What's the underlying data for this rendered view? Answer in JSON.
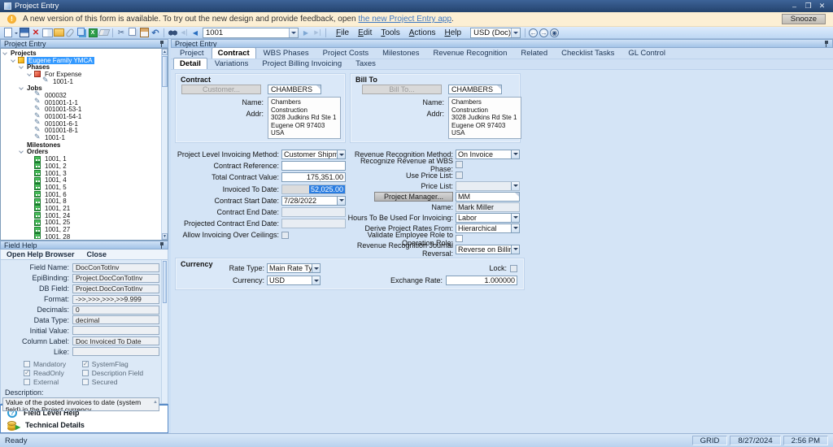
{
  "window": {
    "title": "Project Entry"
  },
  "banner": {
    "message": "A new version of this form is available. To try out the new design and provide feedback, open",
    "link_text": "the new Project Entry app",
    "suffix": ".",
    "snooze_label": "Snooze"
  },
  "toolbar": {
    "record_id": "1001",
    "currency_scope": "USD (Doc)",
    "menus": [
      {
        "label": "File"
      },
      {
        "label": "Edit"
      },
      {
        "label": "Tools"
      },
      {
        "label": "Actions"
      },
      {
        "label": "Help"
      }
    ]
  },
  "left_panel": {
    "header": "Project Entry",
    "tree": {
      "items": [
        {
          "label": "Projects",
          "indent": 0,
          "bold": true,
          "expander": true
        },
        {
          "label": "Eugene Family YMCA",
          "indent": 1,
          "icon": "project-icon",
          "selected": true,
          "expander": true
        },
        {
          "label": "Phases",
          "indent": 2,
          "bold": true,
          "expander": true
        },
        {
          "label": "For Expense",
          "indent": 3,
          "icon": "phase-icon",
          "expander": true
        },
        {
          "label": "1001-1",
          "indent": 4,
          "icon": "job-icon"
        },
        {
          "label": "Jobs",
          "indent": 2,
          "bold": true,
          "expander": true
        },
        {
          "label": "000032",
          "indent": 3,
          "icon": "job-icon"
        },
        {
          "label": "001001-1-1",
          "indent": 3,
          "icon": "job-icon"
        },
        {
          "label": "001001-53-1",
          "indent": 3,
          "icon": "job-icon"
        },
        {
          "label": "001001-54-1",
          "indent": 3,
          "icon": "job-icon"
        },
        {
          "label": "001001-6-1",
          "indent": 3,
          "icon": "job-icon"
        },
        {
          "label": "001001-8-1",
          "indent": 3,
          "icon": "job-icon"
        },
        {
          "label": "1001-1",
          "indent": 3,
          "icon": "job-icon"
        },
        {
          "label": "Milestones",
          "indent": 2,
          "bold": true
        },
        {
          "label": "Orders",
          "indent": 2,
          "bold": true,
          "expander": true
        },
        {
          "label": "1001, 1",
          "indent": 3,
          "icon": "order-icon"
        },
        {
          "label": "1001, 2",
          "indent": 3,
          "icon": "order-icon"
        },
        {
          "label": "1001, 3",
          "indent": 3,
          "icon": "order-icon"
        },
        {
          "label": "1001, 4",
          "indent": 3,
          "icon": "order-icon"
        },
        {
          "label": "1001, 5",
          "indent": 3,
          "icon": "order-icon"
        },
        {
          "label": "1001, 6",
          "indent": 3,
          "icon": "order-icon"
        },
        {
          "label": "1001, 8",
          "indent": 3,
          "icon": "order-icon"
        },
        {
          "label": "1001, 21",
          "indent": 3,
          "icon": "order-icon"
        },
        {
          "label": "1001, 24",
          "indent": 3,
          "icon": "order-icon"
        },
        {
          "label": "1001, 25",
          "indent": 3,
          "icon": "order-icon"
        },
        {
          "label": "1001, 27",
          "indent": 3,
          "icon": "order-icon"
        },
        {
          "label": "1001, 28",
          "indent": 3,
          "icon": "order-icon"
        }
      ]
    }
  },
  "field_help": {
    "header": "Field Help",
    "menu": [
      {
        "label": "Open Help Browser"
      },
      {
        "label": "Close"
      }
    ],
    "rows": [
      {
        "label": "Field Name:",
        "value": "DocConTotInv"
      },
      {
        "label": "EpiBinding:",
        "value": "Project.DocConTotInv"
      },
      {
        "label": "DB Field:",
        "value": "Project.DocConTotInv"
      },
      {
        "label": "Format:",
        "value": "->>,>>>,>>>,>>9.999"
      },
      {
        "label": "Decimals:",
        "value": "0"
      },
      {
        "label": "Data Type:",
        "value": "decimal"
      },
      {
        "label": "Initial Value:",
        "value": ""
      },
      {
        "label": "Column Label:",
        "value": "Doc Invoiced To Date"
      },
      {
        "label": "Like:",
        "value": ""
      }
    ],
    "checkboxes": [
      {
        "label": "Mandatory",
        "checked": false
      },
      {
        "label": "SystemFlag",
        "checked": true
      },
      {
        "label": "ReadOnly",
        "checked": true
      },
      {
        "label": "Description Field",
        "checked": false
      },
      {
        "label": "External",
        "checked": false
      },
      {
        "label": "Secured",
        "checked": false
      }
    ],
    "description_label": "Description:",
    "description": "Value of the posted invoices to date (system field) in the Project currency.",
    "links": [
      {
        "label": "Field Level Help"
      },
      {
        "label": "Technical Details"
      }
    ]
  },
  "main": {
    "header": "Project Entry",
    "tabs": [
      {
        "label": "Project"
      },
      {
        "label": "Contract",
        "active": true
      },
      {
        "label": "WBS Phases"
      },
      {
        "label": "Project Costs"
      },
      {
        "label": "Milestones"
      },
      {
        "label": "Revenue Recognition"
      },
      {
        "label": "Related"
      },
      {
        "label": "Checklist Tasks"
      },
      {
        "label": "GL Control"
      }
    ],
    "subtabs": [
      {
        "label": "Detail",
        "active": true
      },
      {
        "label": "Variations"
      },
      {
        "label": "Project Billing Invoicing"
      },
      {
        "label": "Taxes"
      }
    ],
    "contract": {
      "title": "Contract",
      "button_label": "Customer...",
      "code": "CHAMBERS",
      "name_label": "Name:",
      "addr_label": "Addr:",
      "address": "Chambers Construction\n3028 Judkins Rd Ste 1\nEugene OR 97403\nUSA"
    },
    "bill_to": {
      "title": "Bill To",
      "button_label": "Bill To...",
      "code": "CHAMBERS",
      "name_label": "Name:",
      "addr_label": "Addr:",
      "address": "Chambers Construction\n3028 Judkins Rd Ste 1\nEugene OR 97403\nUSA"
    },
    "fields": {
      "left": {
        "invoicing_method": {
          "label": "Project Level Invoicing Method:",
          "value": "Customer Shipment"
        },
        "contract_reference": {
          "label": "Contract Reference:",
          "value": ""
        },
        "total_contract_value": {
          "label": "Total Contract Value:",
          "value": "175,351.00"
        },
        "invoiced_to_date": {
          "label": "Invoiced To Date:",
          "value": "52,025.00"
        },
        "contract_start_date": {
          "label": "Contract Start Date:",
          "value": "7/28/2022"
        },
        "contract_end_date": {
          "label": "Contract End Date:",
          "value": ""
        },
        "projected_contract_end_date": {
          "label": "Projected Contract End Date:",
          "value": ""
        },
        "allow_invoicing_over_ceilings": {
          "label": "Allow Invoicing Over Ceilings:"
        }
      },
      "right": {
        "revenue_recognition_method": {
          "label": "Revenue Recognition Method:",
          "value": "On Invoice"
        },
        "recognize_revenue_at_wbs_phase": {
          "label": "Recognize Revenue at WBS Phase:"
        },
        "use_price_list": {
          "label": "Use Price List:"
        },
        "price_list": {
          "label": "Price List:",
          "value": ""
        },
        "project_manager": {
          "button_label": "Project Manager...",
          "value": "MM"
        },
        "manager_name": {
          "label": "Name:",
          "value": "Mark Miller"
        },
        "hours_for_invoicing": {
          "label": "Hours To Be Used For Invoicing:",
          "value": "Labor"
        },
        "derive_rates_from": {
          "label": "Derive Project Rates From:",
          "value": "Hierarchical"
        },
        "validate_employee_role": {
          "label": "Validate Employee Role to Operation Role:"
        },
        "revrec_journal_reversal": {
          "label": "Revenue Recognition Journal Reversal:",
          "value": "Reverse on Billing/Shipm"
        }
      }
    },
    "currency": {
      "title": "Currency",
      "rate_type": {
        "label": "Rate Type:",
        "value": "Main Rate Type"
      },
      "currency": {
        "label": "Currency:",
        "value": "USD"
      },
      "lock": {
        "label": "Lock:"
      },
      "exchange_rate": {
        "label": "Exchange Rate:",
        "value": "1.000000"
      }
    }
  },
  "status_bar": {
    "ready": "Ready",
    "cells": [
      "GRID",
      "8/27/2024",
      "2:56 PM"
    ]
  }
}
